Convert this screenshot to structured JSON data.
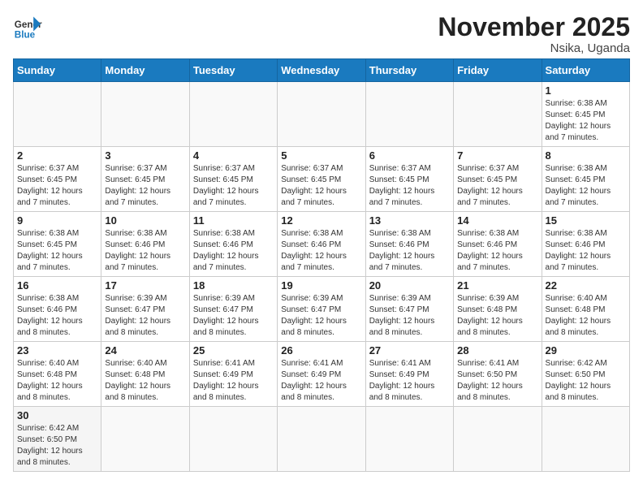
{
  "logo": {
    "general": "General",
    "blue": "Blue"
  },
  "title": "November 2025",
  "location": "Nsika, Uganda",
  "days_of_week": [
    "Sunday",
    "Monday",
    "Tuesday",
    "Wednesday",
    "Thursday",
    "Friday",
    "Saturday"
  ],
  "weeks": [
    [
      {
        "day": "",
        "info": ""
      },
      {
        "day": "",
        "info": ""
      },
      {
        "day": "",
        "info": ""
      },
      {
        "day": "",
        "info": ""
      },
      {
        "day": "",
        "info": ""
      },
      {
        "day": "",
        "info": ""
      },
      {
        "day": "1",
        "info": "Sunrise: 6:38 AM\nSunset: 6:45 PM\nDaylight: 12 hours and 7 minutes."
      }
    ],
    [
      {
        "day": "2",
        "info": "Sunrise: 6:37 AM\nSunset: 6:45 PM\nDaylight: 12 hours and 7 minutes."
      },
      {
        "day": "3",
        "info": "Sunrise: 6:37 AM\nSunset: 6:45 PM\nDaylight: 12 hours and 7 minutes."
      },
      {
        "day": "4",
        "info": "Sunrise: 6:37 AM\nSunset: 6:45 PM\nDaylight: 12 hours and 7 minutes."
      },
      {
        "day": "5",
        "info": "Sunrise: 6:37 AM\nSunset: 6:45 PM\nDaylight: 12 hours and 7 minutes."
      },
      {
        "day": "6",
        "info": "Sunrise: 6:37 AM\nSunset: 6:45 PM\nDaylight: 12 hours and 7 minutes."
      },
      {
        "day": "7",
        "info": "Sunrise: 6:37 AM\nSunset: 6:45 PM\nDaylight: 12 hours and 7 minutes."
      },
      {
        "day": "8",
        "info": "Sunrise: 6:38 AM\nSunset: 6:45 PM\nDaylight: 12 hours and 7 minutes."
      }
    ],
    [
      {
        "day": "9",
        "info": "Sunrise: 6:38 AM\nSunset: 6:45 PM\nDaylight: 12 hours and 7 minutes."
      },
      {
        "day": "10",
        "info": "Sunrise: 6:38 AM\nSunset: 6:46 PM\nDaylight: 12 hours and 7 minutes."
      },
      {
        "day": "11",
        "info": "Sunrise: 6:38 AM\nSunset: 6:46 PM\nDaylight: 12 hours and 7 minutes."
      },
      {
        "day": "12",
        "info": "Sunrise: 6:38 AM\nSunset: 6:46 PM\nDaylight: 12 hours and 7 minutes."
      },
      {
        "day": "13",
        "info": "Sunrise: 6:38 AM\nSunset: 6:46 PM\nDaylight: 12 hours and 7 minutes."
      },
      {
        "day": "14",
        "info": "Sunrise: 6:38 AM\nSunset: 6:46 PM\nDaylight: 12 hours and 7 minutes."
      },
      {
        "day": "15",
        "info": "Sunrise: 6:38 AM\nSunset: 6:46 PM\nDaylight: 12 hours and 7 minutes."
      }
    ],
    [
      {
        "day": "16",
        "info": "Sunrise: 6:38 AM\nSunset: 6:46 PM\nDaylight: 12 hours and 8 minutes."
      },
      {
        "day": "17",
        "info": "Sunrise: 6:39 AM\nSunset: 6:47 PM\nDaylight: 12 hours and 8 minutes."
      },
      {
        "day": "18",
        "info": "Sunrise: 6:39 AM\nSunset: 6:47 PM\nDaylight: 12 hours and 8 minutes."
      },
      {
        "day": "19",
        "info": "Sunrise: 6:39 AM\nSunset: 6:47 PM\nDaylight: 12 hours and 8 minutes."
      },
      {
        "day": "20",
        "info": "Sunrise: 6:39 AM\nSunset: 6:47 PM\nDaylight: 12 hours and 8 minutes."
      },
      {
        "day": "21",
        "info": "Sunrise: 6:39 AM\nSunset: 6:48 PM\nDaylight: 12 hours and 8 minutes."
      },
      {
        "day": "22",
        "info": "Sunrise: 6:40 AM\nSunset: 6:48 PM\nDaylight: 12 hours and 8 minutes."
      }
    ],
    [
      {
        "day": "23",
        "info": "Sunrise: 6:40 AM\nSunset: 6:48 PM\nDaylight: 12 hours and 8 minutes."
      },
      {
        "day": "24",
        "info": "Sunrise: 6:40 AM\nSunset: 6:48 PM\nDaylight: 12 hours and 8 minutes."
      },
      {
        "day": "25",
        "info": "Sunrise: 6:41 AM\nSunset: 6:49 PM\nDaylight: 12 hours and 8 minutes."
      },
      {
        "day": "26",
        "info": "Sunrise: 6:41 AM\nSunset: 6:49 PM\nDaylight: 12 hours and 8 minutes."
      },
      {
        "day": "27",
        "info": "Sunrise: 6:41 AM\nSunset: 6:49 PM\nDaylight: 12 hours and 8 minutes."
      },
      {
        "day": "28",
        "info": "Sunrise: 6:41 AM\nSunset: 6:50 PM\nDaylight: 12 hours and 8 minutes."
      },
      {
        "day": "29",
        "info": "Sunrise: 6:42 AM\nSunset: 6:50 PM\nDaylight: 12 hours and 8 minutes."
      }
    ],
    [
      {
        "day": "30",
        "info": "Sunrise: 6:42 AM\nSunset: 6:50 PM\nDaylight: 12 hours and 8 minutes."
      },
      {
        "day": "",
        "info": ""
      },
      {
        "day": "",
        "info": ""
      },
      {
        "day": "",
        "info": ""
      },
      {
        "day": "",
        "info": ""
      },
      {
        "day": "",
        "info": ""
      },
      {
        "day": "",
        "info": ""
      }
    ]
  ]
}
